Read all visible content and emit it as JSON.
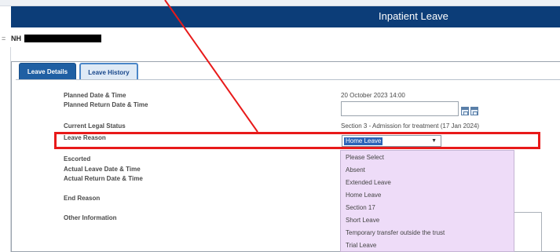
{
  "window": {
    "title": "Inpatient Leave"
  },
  "patient": {
    "bullet": "=",
    "nhs_prefix": "NH"
  },
  "tabs": [
    {
      "label": "Leave Details",
      "active": true
    },
    {
      "label": "Leave History",
      "active": false
    }
  ],
  "form": {
    "planned_date_label": "Planned Date & Time",
    "planned_date_value": "20 October 2023 14:00",
    "planned_return_label": "Planned Return Date & Time",
    "planned_return_value": "",
    "legal_status_label": "Current Legal Status",
    "legal_status_value": "Section 3 - Admission for treatment (17 Jan 2024)",
    "leave_reason_label": "Leave Reason",
    "leave_reason_selected": "Home Leave",
    "escorted_label": "Escorted",
    "actual_leave_label": "Actual Leave Date & Time",
    "actual_return_label": "Actual Return Date & Time",
    "end_reason_label": "End Reason",
    "other_info_label": "Other Information"
  },
  "dropdown_options": [
    "Please Select",
    "Absent",
    "Extended Leave",
    "Home Leave",
    "Section 17",
    "Short Leave",
    "Temporary transfer outside the trust",
    "Trial Leave"
  ],
  "annotation": {
    "color": "#e81a1a"
  },
  "colors": {
    "title_bar": "#0c3d78",
    "active_tab": "#1f5fa3",
    "dropdown_bg": "#eedcf8",
    "selected_bg": "#2b63b8"
  },
  "icons": {
    "calendar": "calendar-icon",
    "dropdown_arrow": "chevron-down-icon"
  }
}
